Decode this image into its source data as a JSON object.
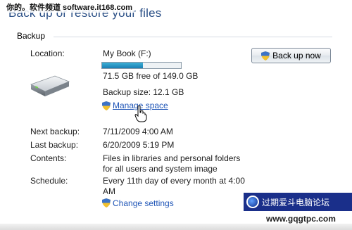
{
  "watermark": "你的。软件频道 software.it168.com",
  "page_title": "Back up or restore your files",
  "section": {
    "title": "Backup"
  },
  "location": {
    "label": "Location:",
    "value": "My Book (F:)",
    "free_text": "71.5 GB free of 149.0 GB",
    "used_fraction": 0.52
  },
  "backup_size": "Backup size: 12.1 GB",
  "manage_space_link": "Manage space",
  "next_backup": {
    "label": "Next backup:",
    "value": "7/11/2009 4:00 AM"
  },
  "last_backup": {
    "label": "Last backup:",
    "value": "6/20/2009 5:19 PM"
  },
  "contents": {
    "label": "Contents:",
    "value": "Files in libraries and personal folders for all users and system image"
  },
  "schedule": {
    "label": "Schedule:",
    "value": "Every 11th day of every month at 4:00 AM"
  },
  "change_settings_link": "Change settings",
  "back_up_now_button": "Back up now",
  "forum_badge": {
    "text": "过期爱斗电脑论坛",
    "url": "www.gqgtpc.com"
  },
  "colors": {
    "title": "#2a4f86",
    "link": "#1f55b7",
    "progress": "#1a7fb3",
    "badge_bg": "#1a2f8a"
  },
  "icons": [
    "shield-icon",
    "drive-icon",
    "hand-cursor-icon"
  ]
}
